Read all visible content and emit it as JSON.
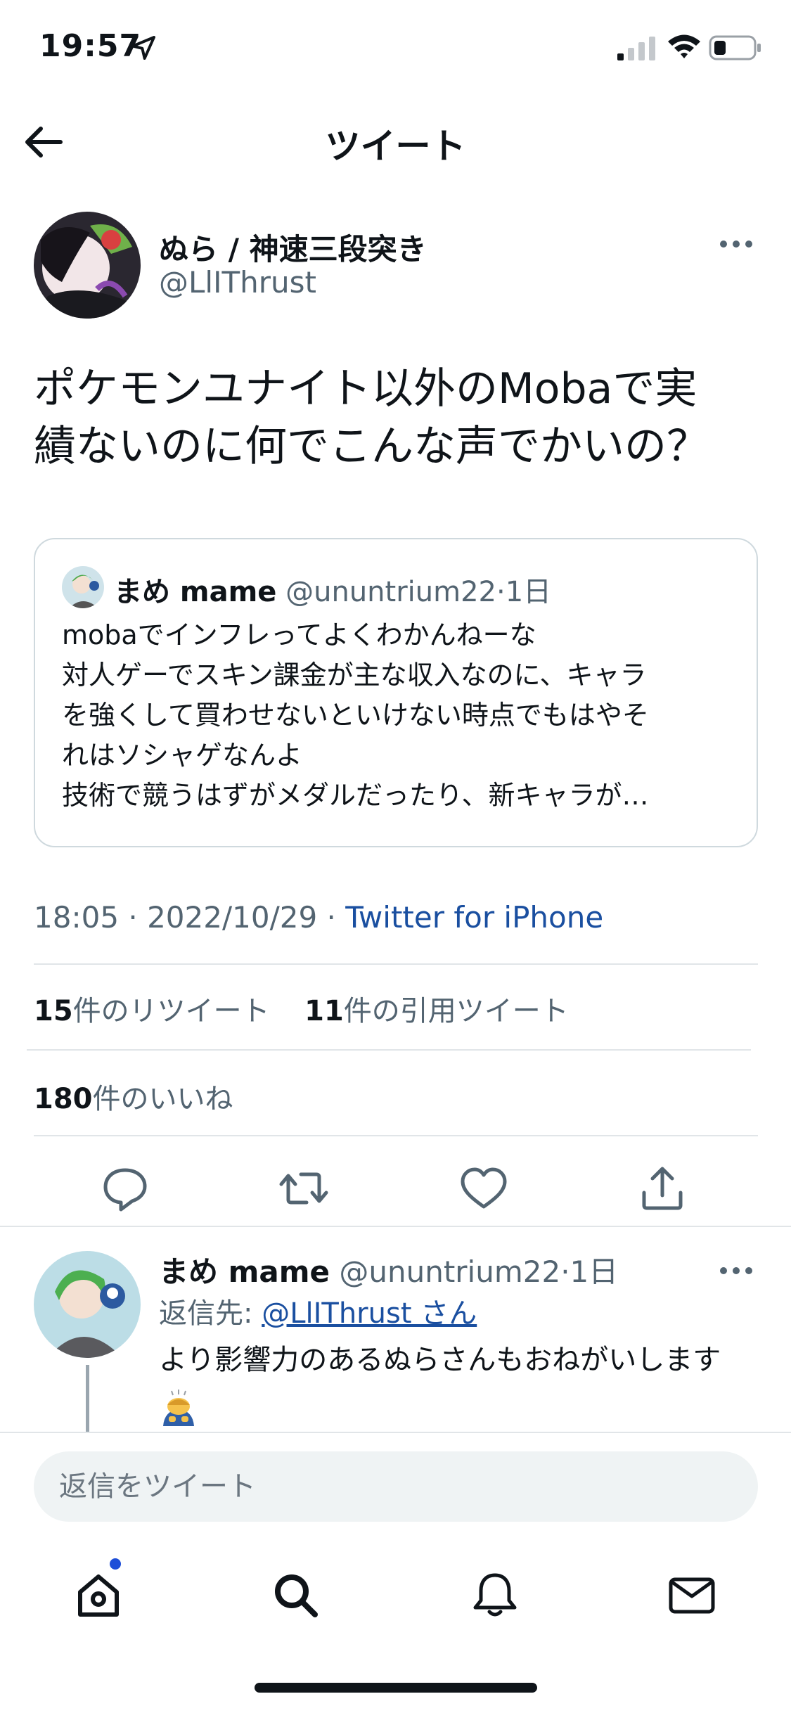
{
  "status_bar": {
    "time": "19:57"
  },
  "nav": {
    "title": "ツイート"
  },
  "tweet": {
    "author_name": "ぬら / 神速三段突き",
    "author_handle": "@LlIThrust",
    "text": "ポケモンユナイト以外のMobaで実績ないのに何でこんな声でかいの？",
    "text_lines": [
      "ポケモンユナイト以外のMobaで実",
      "績ないのに何でこんな声でかいの？"
    ],
    "timestamp": "18:05 · 2022/10/29 · ",
    "source": "Twitter for iPhone",
    "retweets_count": "15",
    "retweets_label": "件のリツイート",
    "quotes_count": "11",
    "quotes_label": "件の引用ツイート",
    "likes_count": "180",
    "likes_label": "件のいいね"
  },
  "quoted_tweet": {
    "author_name": "まめ mame",
    "author_handle": "@ununtrium22",
    "time": "·1日",
    "lines": [
      "mobaでインフレってよくわかんねーな",
      "対人ゲーでスキン課金が主な収入なのに、キャラ",
      "を強くして買わせないといけない時点でもはやそ",
      "れはソシャゲなんよ",
      "技術で競うはずがメダルだったり、新キャラが…"
    ]
  },
  "reply": {
    "author_name": "まめ mame",
    "author_handle": "@ununtrium22",
    "time": "·1日",
    "replying_to_label": "返信先: ",
    "replying_to_user": "@LlIThrust さん",
    "text": "より影響力のあるぬらさんもおねがいします"
  },
  "compose": {
    "placeholder": "返信をツイート"
  },
  "colors": {
    "link_blue": "#1a4fa0",
    "secondary_text": "#536471",
    "notification_dot": "#1d4ed8"
  }
}
